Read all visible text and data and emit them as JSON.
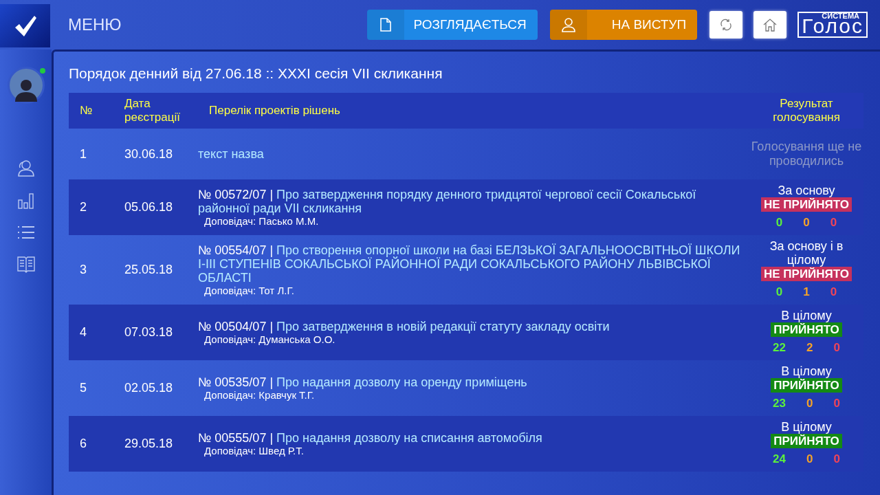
{
  "header": {
    "menu_label": "МЕНЮ",
    "buttons": [
      {
        "label": "РОЗГЛЯДАЄТЬСЯ",
        "kind": "document"
      },
      {
        "label": "НА ВИСТУП",
        "kind": "speaker"
      }
    ],
    "logo": {
      "caption": "СИСТЕМА",
      "name": "Голос"
    }
  },
  "user": {
    "online": true
  },
  "agenda": {
    "title": "Порядок денний від 27.06.18 :: XXXI сесія VII скликання",
    "columns": [
      "№",
      "Дата реєстрації",
      "Перелік проектів рішень",
      "Результат голосування"
    ],
    "rows": [
      {
        "number": "1",
        "date": "30.06.18",
        "title": "текст назва",
        "result": {
          "kind": "pending",
          "text": "Голосування ще не проводились"
        }
      },
      {
        "number": "2",
        "date": "05.06.18",
        "doc_number": "№ 00572/07 |",
        "title": "Про затвердження порядку денного тридцятої чергової сесії Сокальської районної ради VII скликання",
        "reporter": "Доповідач: Пасько М.М.",
        "result": {
          "kind": "voted",
          "stage": "За основу",
          "verdict": "НЕ ПРИЙНЯТО",
          "accepted": false,
          "votes_for": "0",
          "votes_abstained": "0",
          "votes_against": "0"
        }
      },
      {
        "number": "3",
        "date": "25.05.18",
        "doc_number": "№ 00554/07 |",
        "title": "Про створення опорної школи на базі БЕЛЗЬКОЇ ЗАГАЛЬНООСВІТНЬОЇ ШКОЛИ І-ІІІ СТУПЕНІВ  СОКАЛЬСЬКОЇ РАЙОННОЇ РАДИ СОКАЛЬСЬКОГО РАЙОНУ ЛЬВІВСЬКОЇ ОБЛАСТІ",
        "reporter": "Доповідач: Тот Л.Г.",
        "result": {
          "kind": "voted",
          "stage": "За основу і в цілому",
          "verdict": "НЕ ПРИЙНЯТО",
          "accepted": false,
          "votes_for": "0",
          "votes_abstained": "1",
          "votes_against": "0"
        }
      },
      {
        "number": "4",
        "date": "07.03.18",
        "doc_number": "№ 00504/07 |",
        "title": "Про затвердження в новій редакції статуту закладу освіти",
        "reporter": "Доповідач: Думанська О.О.",
        "result": {
          "kind": "voted",
          "stage": "В цілому",
          "verdict": "ПРИЙНЯТО",
          "accepted": true,
          "votes_for": "22",
          "votes_abstained": "2",
          "votes_against": "0"
        }
      },
      {
        "number": "5",
        "date": "02.05.18",
        "doc_number": "№ 00535/07 |",
        "title": "Про надання дозволу на оренду приміщень",
        "reporter": "Доповідач: Кравчук Т.Г.",
        "result": {
          "kind": "voted",
          "stage": "В цілому",
          "verdict": "ПРИЙНЯТО",
          "accepted": true,
          "votes_for": "23",
          "votes_abstained": "0",
          "votes_against": "0"
        }
      },
      {
        "number": "6",
        "date": "29.05.18",
        "doc_number": "№ 00555/07 |",
        "title": "Про надання дозволу на списання автомобіля",
        "reporter": "Доповідач: Швед Р.Т.",
        "result": {
          "kind": "voted",
          "stage": "В цілому",
          "verdict": "ПРИЙНЯТО",
          "accepted": true,
          "votes_for": "24",
          "votes_abstained": "0",
          "votes_against": "0"
        }
      }
    ]
  }
}
